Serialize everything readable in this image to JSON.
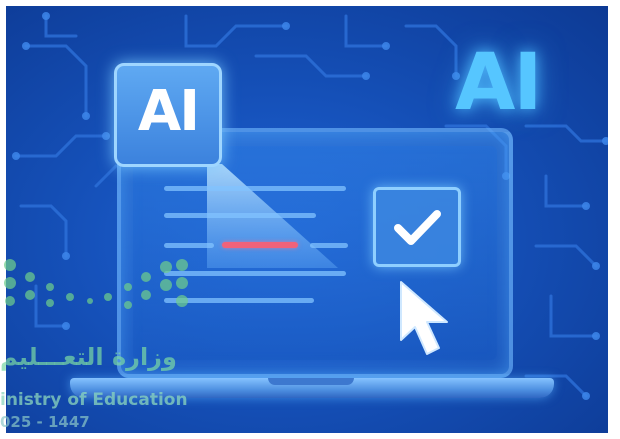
{
  "illustration": {
    "badge_text": "AI",
    "large_text": "AI",
    "checkbox_checked": true,
    "colors": {
      "background": "#1550b8",
      "accent_glow": "#56c6ff",
      "highlight": "#f0627a",
      "badge_fill": "#4a92e6"
    },
    "icons": [
      "circuit-pattern",
      "ai-badge-icon",
      "checkbox-icon",
      "checkmark-icon",
      "mouse-pointer-icon",
      "laptop-icon"
    ]
  },
  "watermark": {
    "arabic_text": "وزارة التعـــليم",
    "english_text": "inistry of Education",
    "year_text": "025 - 1447"
  }
}
